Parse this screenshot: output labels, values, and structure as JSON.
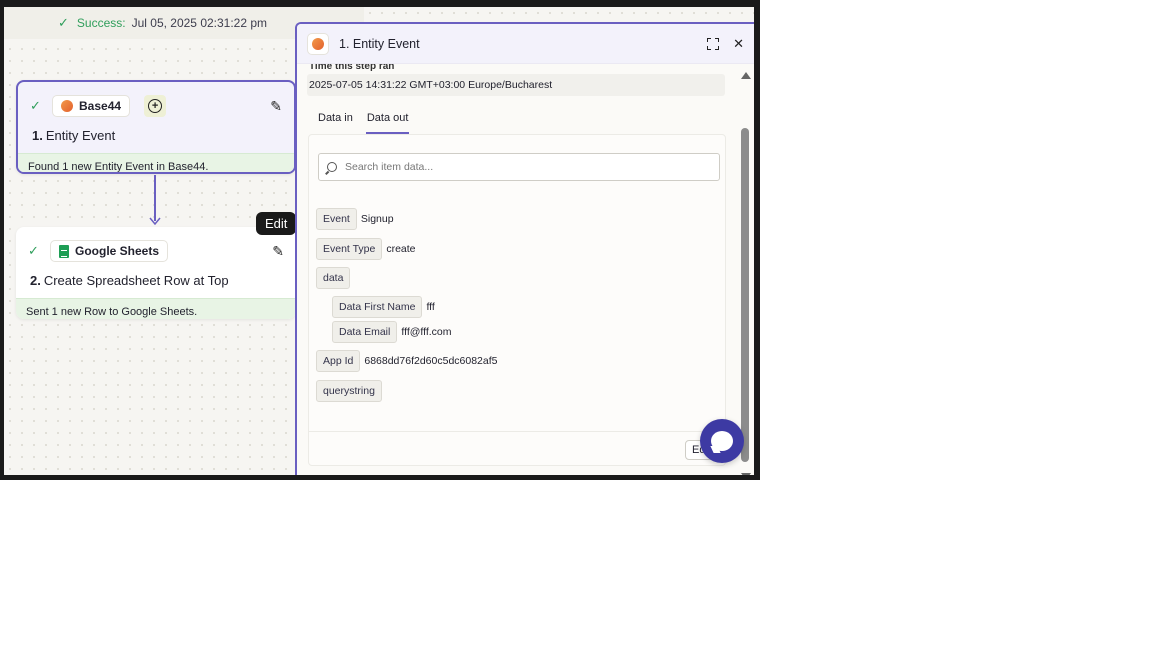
{
  "status": {
    "label": "Success:",
    "timestamp": "Jul 05, 2025 02:31:22 pm"
  },
  "steps": [
    {
      "number": "1.",
      "app": "Base44",
      "title": "Entity Event",
      "result": "Found 1 new Entity Event in Base44."
    },
    {
      "number": "2.",
      "app": "Google Sheets",
      "title": "Create Spreadsheet Row at Top",
      "result": "Sent 1 new Row to Google Sheets."
    }
  ],
  "tooltip": {
    "text": "Edit"
  },
  "panel": {
    "title": "1. Entity Event",
    "time_label": "Time this step ran",
    "time_value": "2025-07-05 14:31:22 GMT+03:00 Europe/Bucharest",
    "tabs": [
      "Data in",
      "Data out"
    ],
    "search_placeholder": "Search item data...",
    "fields": {
      "event": {
        "key": "Event",
        "value": "Signup"
      },
      "event_type": {
        "key": "Event Type",
        "value": "create"
      },
      "data": {
        "key": "data"
      },
      "data_first_name": {
        "key": "Data First Name",
        "value": "fff"
      },
      "data_email": {
        "key": "Data Email",
        "value": "fff@fff.com"
      },
      "app_id": {
        "key": "App Id",
        "value": "6868dd76f2d60c5dc6082af5"
      },
      "querystring": {
        "key": "querystring"
      }
    },
    "edit_label": "Edit"
  },
  "colors": {
    "accent": "#6a5fc1",
    "success": "#2f9e5b",
    "chat": "#3d3aa3"
  }
}
